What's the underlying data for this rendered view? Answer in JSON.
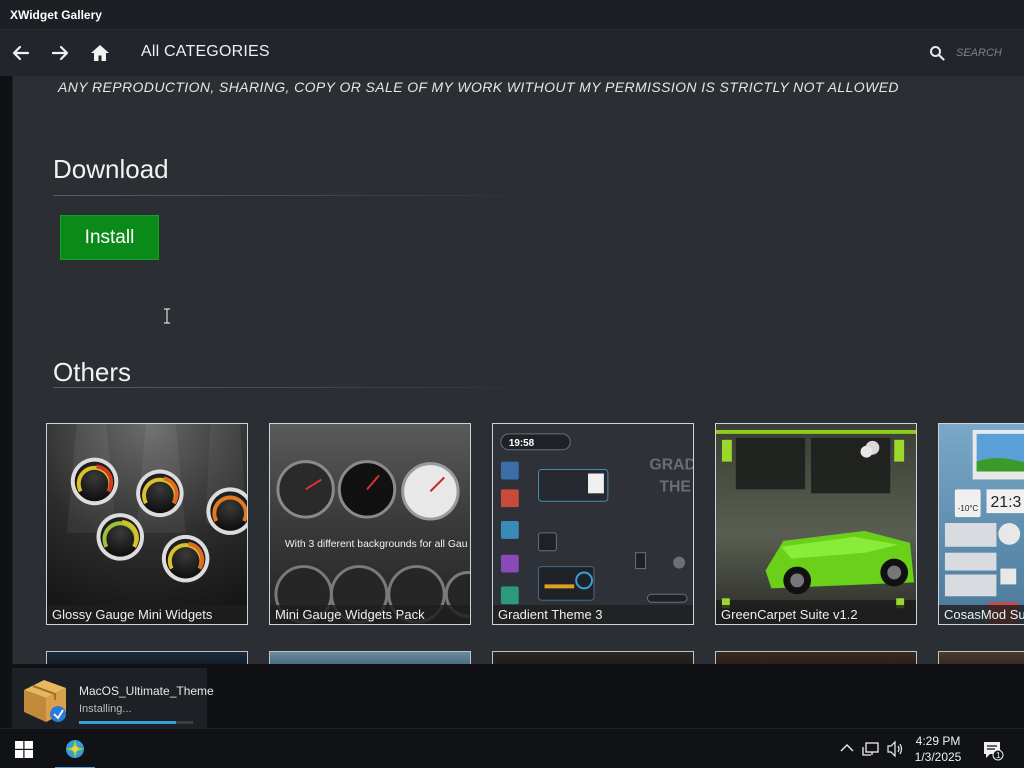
{
  "window": {
    "title": "XWidget Gallery"
  },
  "nav": {
    "breadcrumb": "All CATEGORIES",
    "search_placeholder": "SEARCH"
  },
  "content": {
    "notice": "ANY REPRODUCTION, SHARING, COPY OR SALE OF MY WORK WITHOUT MY PERMISSION IS STRICTLY NOT ALLOWED",
    "download_title": "Download",
    "install_label": "Install",
    "others_title": "Others",
    "cards": [
      {
        "title": "Glossy Gauge Mini Widgets"
      },
      {
        "title": "Mini Gauge Widgets Pack",
        "overlay_text": "With 3 different backgrounds for all Gau"
      },
      {
        "title": "Gradient Theme 3",
        "clock_text": "19:58",
        "bg_text_1": "GRAD",
        "bg_text_2": "THE"
      },
      {
        "title": "GreenCarpet Suite v1.2"
      },
      {
        "title": "CosasMod Su",
        "clock_text": "21:3",
        "temp_text": "-10°C"
      }
    ]
  },
  "notification": {
    "name": "MacOS_Ultimate_Theme",
    "status": "Installing...",
    "progress": 0.85
  },
  "taskbar": {
    "time": "4:29 PM",
    "date": "1/3/2025",
    "notification_count": "1"
  }
}
